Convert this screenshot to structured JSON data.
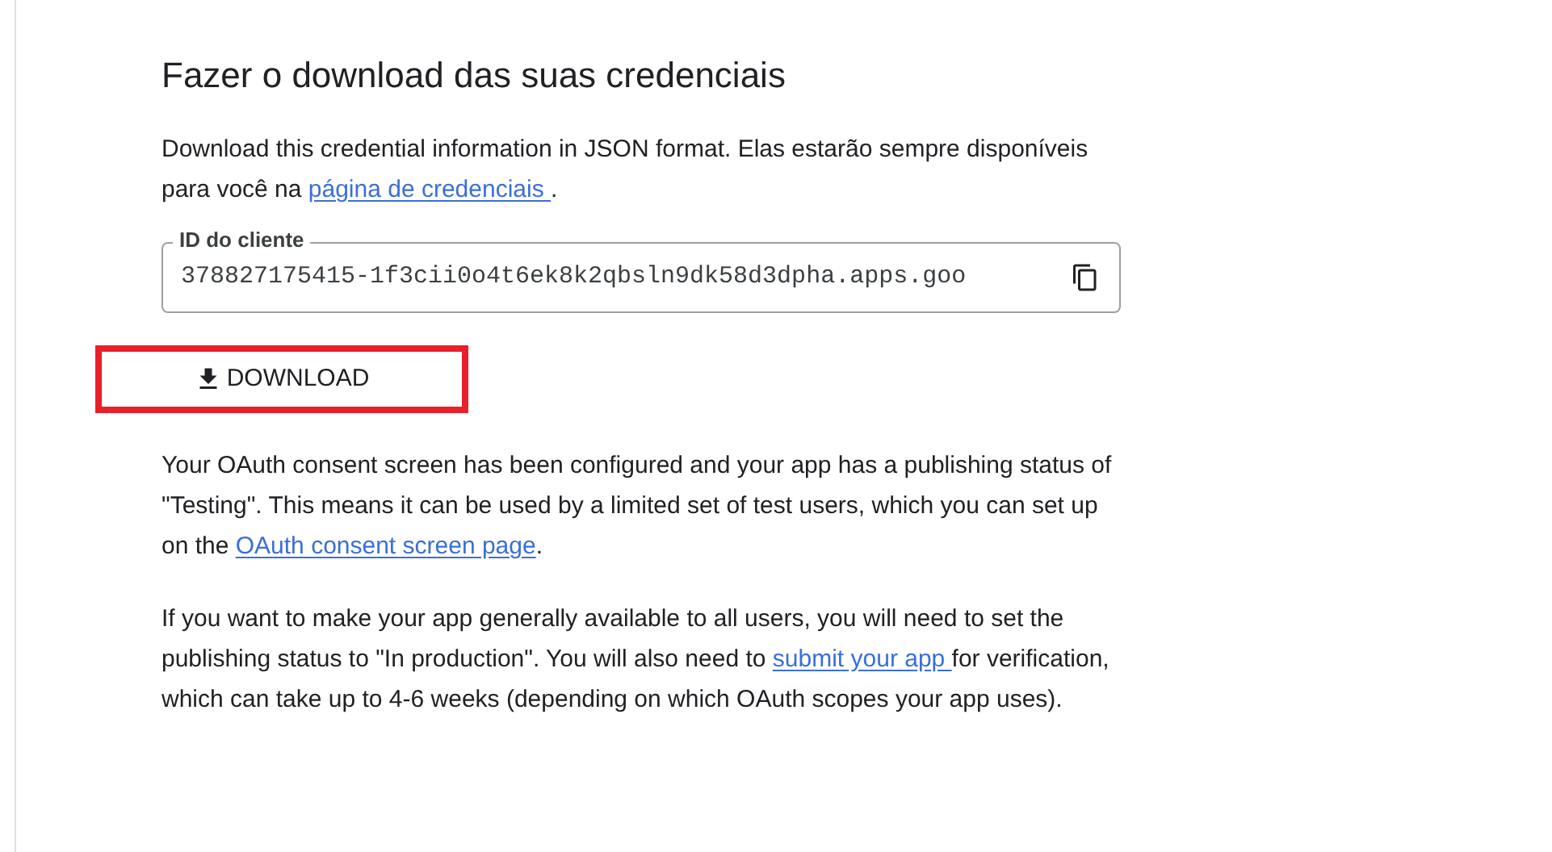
{
  "title": "Fazer o download das suas credenciais",
  "intro": [
    {
      "kind": "text",
      "text": "Download this credential information in JSON format. Elas estarão sempre disponíveis para você na "
    },
    {
      "kind": "link",
      "text": "página de credenciais "
    },
    {
      "kind": "text",
      "text": "."
    }
  ],
  "client_id_field": {
    "label": "ID do cliente",
    "value": "378827175415-1f3cii0o4t6ek8k2qbsln9dk58d3dpha.apps.goo"
  },
  "download_button": {
    "label": "DOWNLOAD",
    "highlighted": true
  },
  "paragraphs": [
    [
      {
        "kind": "text",
        "text": "Your OAuth consent screen has been configured and your app has a publishing status of \"Testing\". This means it can be used by a limited set of test users, which you can set up on the "
      },
      {
        "kind": "link",
        "text": "OAuth consent screen page"
      },
      {
        "kind": "text",
        "text": "."
      }
    ],
    [
      {
        "kind": "text",
        "text": "If you want to make your app generally available to all users, you will need to set the publishing status to \"In production\". You will also need to "
      },
      {
        "kind": "link",
        "text": "submit your app "
      },
      {
        "kind": "text",
        "text": "for verification, which can take up to 4-6 weeks (depending on which OAuth scopes your app uses)."
      }
    ]
  ]
}
